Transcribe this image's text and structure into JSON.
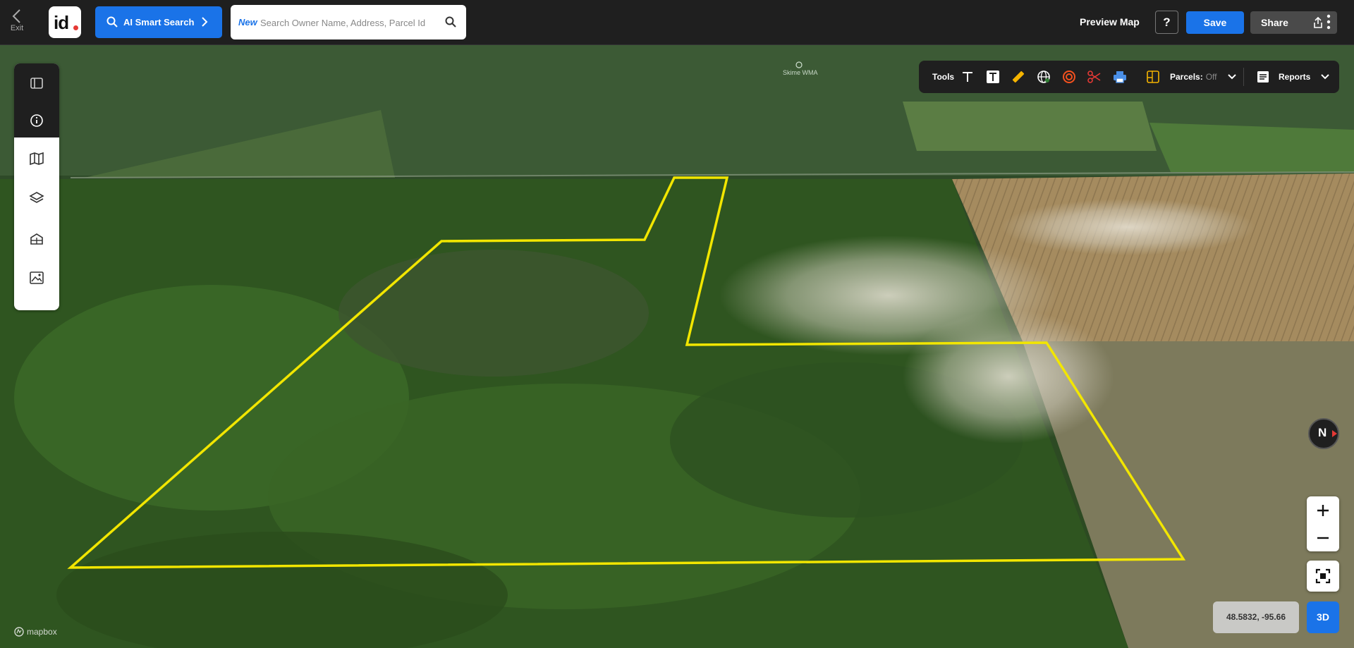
{
  "header": {
    "exit_label": "Exit",
    "logo_text": "id",
    "ai_search_label": "AI Smart Search",
    "search_new_tag": "New",
    "search_placeholder": "Search Owner Name, Address, Parcel Id",
    "preview_label": "Preview Map",
    "help_label": "?",
    "save_label": "Save",
    "share_label": "Share"
  },
  "sidebar": {
    "items": [
      {
        "icon": "collapse-panel-icon"
      },
      {
        "icon": "info-icon"
      },
      {
        "icon": "map-icon"
      },
      {
        "icon": "layers-icon"
      },
      {
        "icon": "buildings-icon"
      },
      {
        "icon": "image-icon"
      }
    ]
  },
  "tools": {
    "label": "Tools",
    "parcels_label": "Parcels:",
    "parcels_value": "Off",
    "reports_label": "Reports",
    "icons": [
      "text-icon",
      "text-box-icon",
      "ruler-icon",
      "globe-icon",
      "radius-icon",
      "scissors-icon",
      "print-icon"
    ]
  },
  "map": {
    "poi_label": "Skime WMA",
    "boundary_color": "#f2e600"
  },
  "controls": {
    "compass_label": "N",
    "coords": "48.5832, -95.66",
    "mode_3d_label": "3D",
    "attribution": "mapbox"
  },
  "colors": {
    "accent": "#1a73e8",
    "bar": "#1f1f1f"
  }
}
